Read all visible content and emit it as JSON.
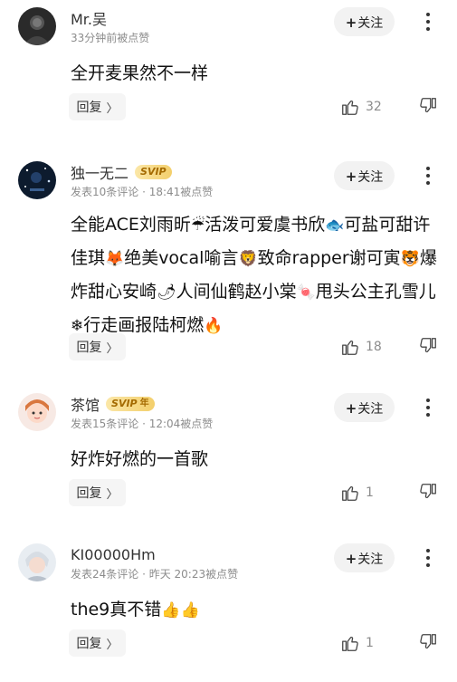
{
  "follow_label": "关注",
  "reply_label": "回复",
  "comments": [
    {
      "user": "Mr.吴",
      "meta": "33分钟前被点赞",
      "vip": null,
      "content_parts": [
        "全开麦果然不一样"
      ],
      "likes": "32"
    },
    {
      "user": "独一无二",
      "meta": "发表10条评论 · 18:41被点赞",
      "vip": "SVIP",
      "content_parts": [
        "全能ACE刘雨昕",
        "活泼可爱虞书欣",
        "可盐可甜许佳琪",
        "绝美vocal喻言",
        "致命rapper谢可寅",
        "爆炸甜心安崎",
        "人间仙鹤赵小棠",
        "甩头公主孔雪儿",
        "行走画报陆柯燃"
      ],
      "emojis": [
        "umbrella",
        "fish",
        "fox",
        "lion",
        "tiger",
        "pepper",
        "candy",
        "snowflake",
        "fire"
      ],
      "likes": "18"
    },
    {
      "user": "茶馆",
      "meta": "发表15条评论 · 12:04被点赞",
      "vip": "SVIP",
      "vip_year": "年",
      "content_parts": [
        "好炸好燃的一首歌"
      ],
      "likes": "1"
    },
    {
      "user": "KI00000Hm",
      "meta": "发表24条评论 · 昨天 20:23被点赞",
      "vip": null,
      "content_parts": [
        "the9真不错"
      ],
      "emojis": [
        "thumbs-up",
        "thumbs-up"
      ],
      "likes": "1"
    }
  ]
}
